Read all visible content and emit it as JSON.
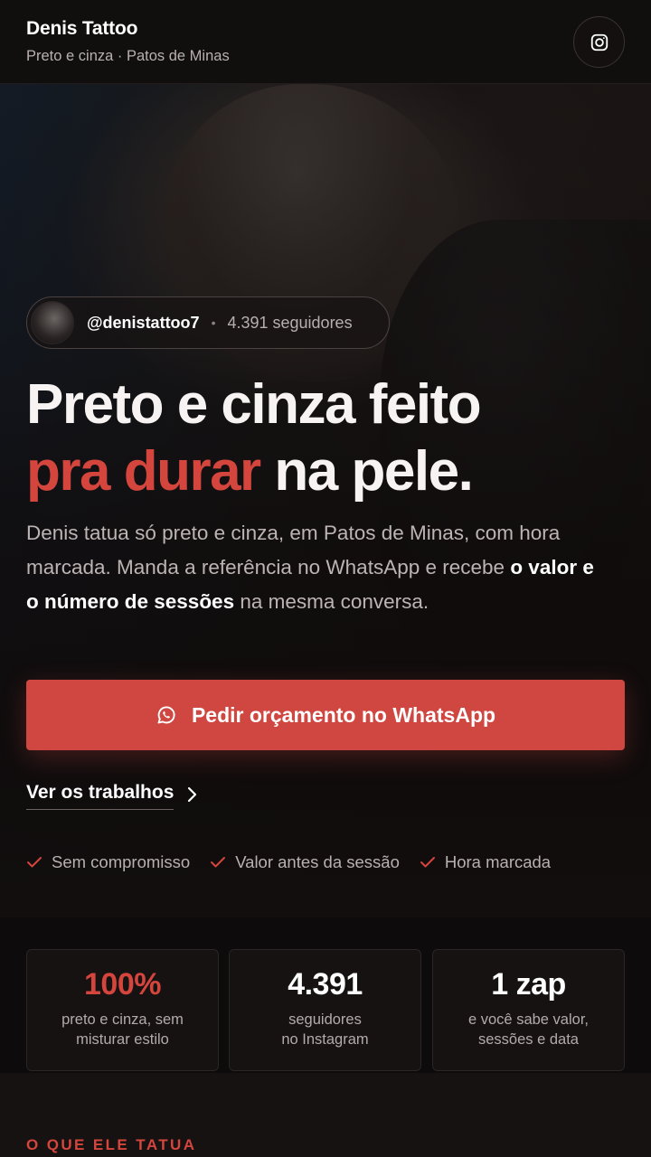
{
  "header": {
    "brand_name": "Denis Tattoo",
    "brand_sub": "Preto e cinza · Patos de Minas",
    "instagram_icon": "instagram-icon"
  },
  "hero": {
    "profile": {
      "handle": "@denistattoo7",
      "separator": "•",
      "followers": "4.391 seguidores"
    },
    "headline": {
      "line1": "Preto e cinza feito",
      "accent": "pra durar",
      "line2_rest": " na pele."
    },
    "lede": {
      "part1": "Denis tatua só preto e cinza, em Patos de Minas, com hora marcada. Manda a referência no WhatsApp e recebe ",
      "bold": "o valor e o número de sessões",
      "part2": " na mesma conversa."
    },
    "cta_label": "Pedir orçamento no WhatsApp",
    "works_link": "Ver os trabalhos",
    "checks": [
      "Sem compromisso",
      "Valor antes da sessão",
      "Hora marcada"
    ]
  },
  "stats": [
    {
      "value": "100%",
      "line1": "preto e cinza, sem",
      "line2": "misturar estilo"
    },
    {
      "value": "4.391",
      "line1": "seguidores",
      "line2": "no Instagram"
    },
    {
      "value": "1 zap",
      "line1": "e você sabe valor,",
      "line2": "sessões e data"
    }
  ],
  "section": {
    "kicker": "O QUE ELE TATUA"
  },
  "colors": {
    "accent": "#d4453d",
    "cta": "#cf4740",
    "background": "#0f0c0c"
  }
}
